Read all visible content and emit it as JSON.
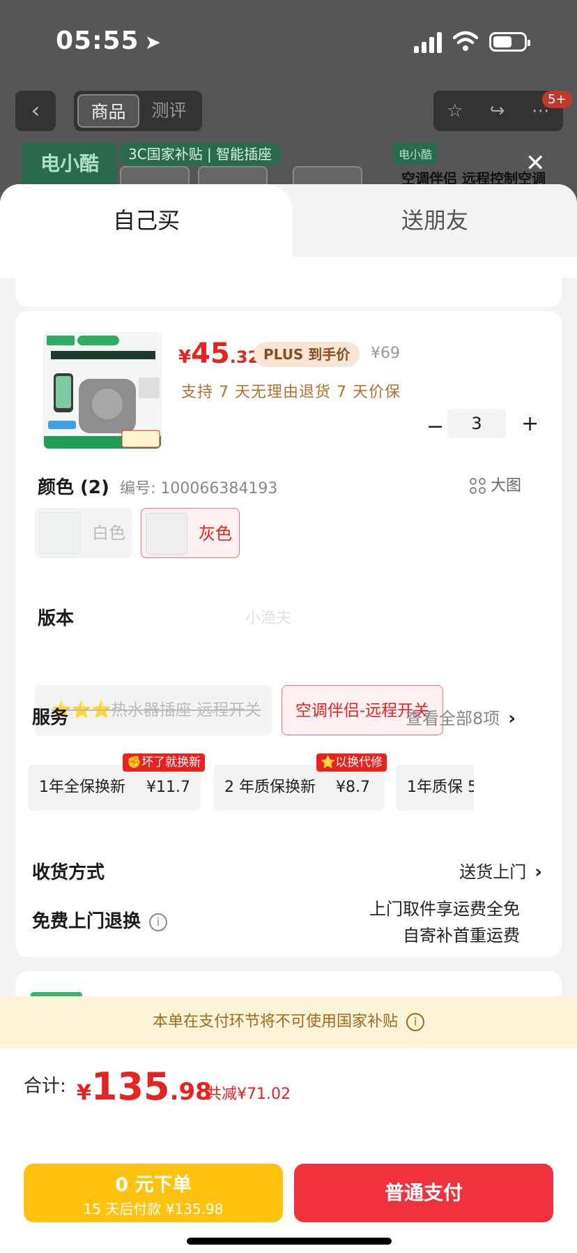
{
  "status_bar": {
    "time": "05:55"
  },
  "nav": {
    "back_icon": "chevron-left-icon",
    "segments": [
      "商品",
      "测评"
    ],
    "badge": "5+"
  },
  "background_product": {
    "logo": "电小酷",
    "tag": "3C国家补贴 | 智能插座",
    "title": "空调伴侣 远程控制空调"
  },
  "tabs": {
    "buy_self": "自己买",
    "gift": "送朋友"
  },
  "product": {
    "price_currency": "¥",
    "price_int": "45",
    "price_dec": ".32",
    "plus_tag": "PLUS 到手价",
    "original_price": "¥69",
    "support": "支持 7 天无理由退货   7 天价保",
    "quantity": "3"
  },
  "color": {
    "title": "颜色 (2)",
    "code": "编号: 100066384193",
    "big_image": "大图",
    "options": [
      {
        "label": "白色",
        "disabled": true
      },
      {
        "label": "灰色",
        "selected": true
      }
    ]
  },
  "version": {
    "title": "版本",
    "options": [
      {
        "label": "⭐⭐⭐热水器插座 远程开关",
        "disabled": true
      },
      {
        "label": "空调伴侣-远程开关",
        "selected": true
      }
    ],
    "watermark": "小渔夫"
  },
  "service": {
    "title": "服务",
    "view_all": "查看全部8项",
    "items": [
      {
        "name": "1年全保换新",
        "price": "¥11.7",
        "badge": "✊坏了就换新"
      },
      {
        "name": "2 年质保换新",
        "price": "¥8.7",
        "badge": "⭐以换代修"
      },
      {
        "name": "1年质保 5"
      }
    ]
  },
  "delivery": {
    "title": "收货方式",
    "value": "送货上门"
  },
  "free_return": {
    "title": "免费上门退换",
    "line1": "上门取件享运费全免",
    "line2": "自寄补首重运费"
  },
  "notice": "本单在支付环节将不可使用国家补贴",
  "bottom": {
    "total_label": "合计:",
    "total_currency": "¥",
    "total_int": "135",
    "total_dec": ".98",
    "discount": "共减¥71.02",
    "btn_zero_line1": "0 元下单",
    "btn_zero_line2": "15 天后付款 ¥135.98",
    "btn_pay": "普通支付"
  },
  "colors": {
    "accent_red": "#e8231f",
    "pay_red": "#f0323e",
    "yellow": "#ffc30f"
  }
}
